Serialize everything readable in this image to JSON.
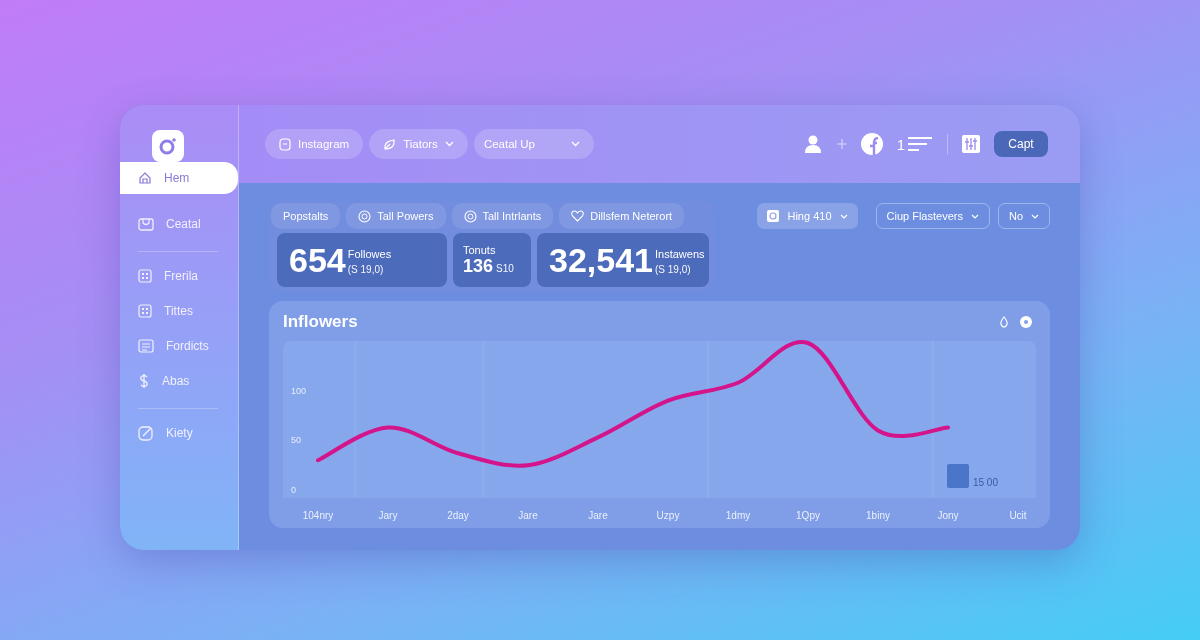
{
  "sidebar": {
    "items": [
      {
        "label": "Hem",
        "selected": true,
        "kind": "home"
      },
      {
        "label": "Ceatal",
        "selected": false,
        "kind": "inbox"
      },
      {
        "label": "Frerila",
        "selected": false,
        "kind": "grid"
      },
      {
        "label": "Tittes",
        "selected": false,
        "kind": "grid"
      },
      {
        "label": "Fordicts",
        "selected": false,
        "kind": "list"
      },
      {
        "label": "Abas",
        "selected": false,
        "kind": "dollar"
      },
      {
        "label": "Kiety",
        "selected": false,
        "kind": "edit"
      }
    ]
  },
  "topbar": {
    "chips": [
      {
        "label": "Instagram",
        "kind": "icon"
      },
      {
        "label": "Tiators",
        "kind": "icon-dropdown"
      },
      {
        "label": "Ceatal Up",
        "kind": "dropdown"
      }
    ],
    "count": "1",
    "button": "Capt"
  },
  "tabs": [
    {
      "label": "Popstalts",
      "kind": "plain"
    },
    {
      "label": "Tall Powers",
      "kind": "icon"
    },
    {
      "label": "Tall Intrlants",
      "kind": "icon"
    },
    {
      "label": "Dillsfem Neterort",
      "kind": "heart"
    }
  ],
  "filters": [
    {
      "label": "Hing 410",
      "kind": "filled"
    },
    {
      "label": "Ciup Flastevers",
      "kind": "outline"
    },
    {
      "label": "No",
      "kind": "outline"
    }
  ],
  "stats": [
    {
      "kind": "inline",
      "value": "654",
      "label": "Followes",
      "sub": "(S 19,0)"
    },
    {
      "kind": "stacked",
      "value": "136",
      "label": "Tonuts",
      "sub": "S10"
    },
    {
      "kind": "inline",
      "value": "32,541",
      "label": "Instawens",
      "sub": "(S 19,0)"
    }
  ],
  "chart": {
    "legend": "15 00",
    "chart_data": {
      "type": "line",
      "title": "Inflowers",
      "categories": [
        "104nry",
        "Jary",
        "2day",
        "Jare",
        "Jare",
        "Uzpy",
        "1dmy",
        "1Qpy",
        "1biny",
        "Jony",
        "Ucit"
      ],
      "series": [
        {
          "color": "#d4148a",
          "values": [
            30,
            63,
            37,
            25,
            53,
            90,
            108,
            148,
            60,
            63,
            null
          ]
        }
      ],
      "ylim": [
        -8,
        150
      ],
      "yticks": [
        100,
        50,
        0
      ]
    }
  }
}
